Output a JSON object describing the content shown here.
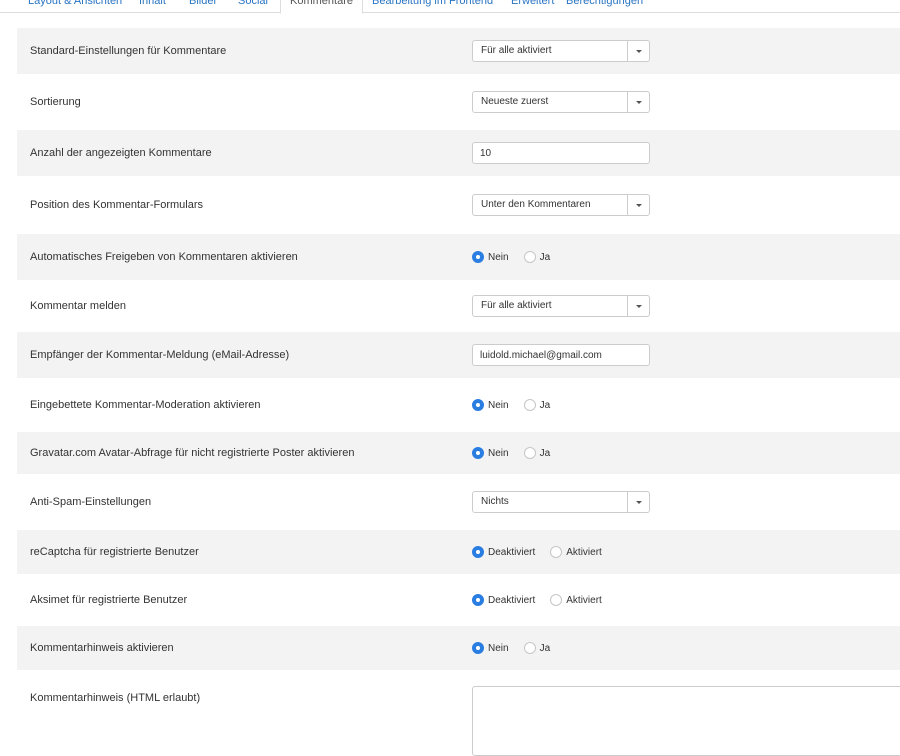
{
  "tabs": [
    {
      "label": "Layout & Ansichten"
    },
    {
      "label": "Inhalt"
    },
    {
      "label": "Bilder"
    },
    {
      "label": "Social"
    },
    {
      "label": "Kommentare",
      "active": true
    },
    {
      "label": "Bearbeitung im Frontend"
    },
    {
      "label": "Erweitert"
    },
    {
      "label": "Berechtigungen"
    }
  ],
  "settings": {
    "standard": {
      "label": "Standard-Einstellungen für Kommentare",
      "value": "Für alle aktiviert"
    },
    "sort": {
      "label": "Sortierung",
      "value": "Neueste zuerst"
    },
    "count": {
      "label": "Anzahl der angezeigten Kommentare",
      "value": "10"
    },
    "position": {
      "label": "Position des Kommentar-Formulars",
      "value": "Unter den Kommentaren"
    },
    "autoapprove": {
      "label": "Automatisches Freigeben von Kommentaren aktivieren",
      "opt1": "Nein",
      "opt2": "Ja",
      "selected": "Nein"
    },
    "report": {
      "label": "Kommentar melden",
      "value": "Für alle aktiviert"
    },
    "recipient": {
      "label": "Empfänger der Kommentar-Meldung (eMail-Adresse)",
      "value": "luidold.michael@gmail.com"
    },
    "moderation": {
      "label": "Eingebettete Kommentar-Moderation aktivieren",
      "opt1": "Nein",
      "opt2": "Ja",
      "selected": "Nein"
    },
    "gravatar": {
      "label": "Gravatar.com Avatar-Abfrage für nicht registrierte Poster aktivieren",
      "opt1": "Nein",
      "opt2": "Ja",
      "selected": "Nein"
    },
    "antispam": {
      "label": "Anti-Spam-Einstellungen",
      "value": "Nichts"
    },
    "recaptcha": {
      "label": "reCaptcha für registrierte Benutzer",
      "opt1": "Deaktiviert",
      "opt2": "Aktiviert",
      "selected": "Deaktiviert"
    },
    "akismet": {
      "label": "Aksimet für registrierte Benutzer",
      "opt1": "Deaktiviert",
      "opt2": "Aktiviert",
      "selected": "Deaktiviert"
    },
    "notice": {
      "label": "Kommentarhinweis aktivieren",
      "opt1": "Nein",
      "opt2": "Ja",
      "selected": "Nein"
    },
    "notice_html": {
      "label": "Kommentarhinweis (HTML erlaubt)",
      "value": ""
    }
  }
}
